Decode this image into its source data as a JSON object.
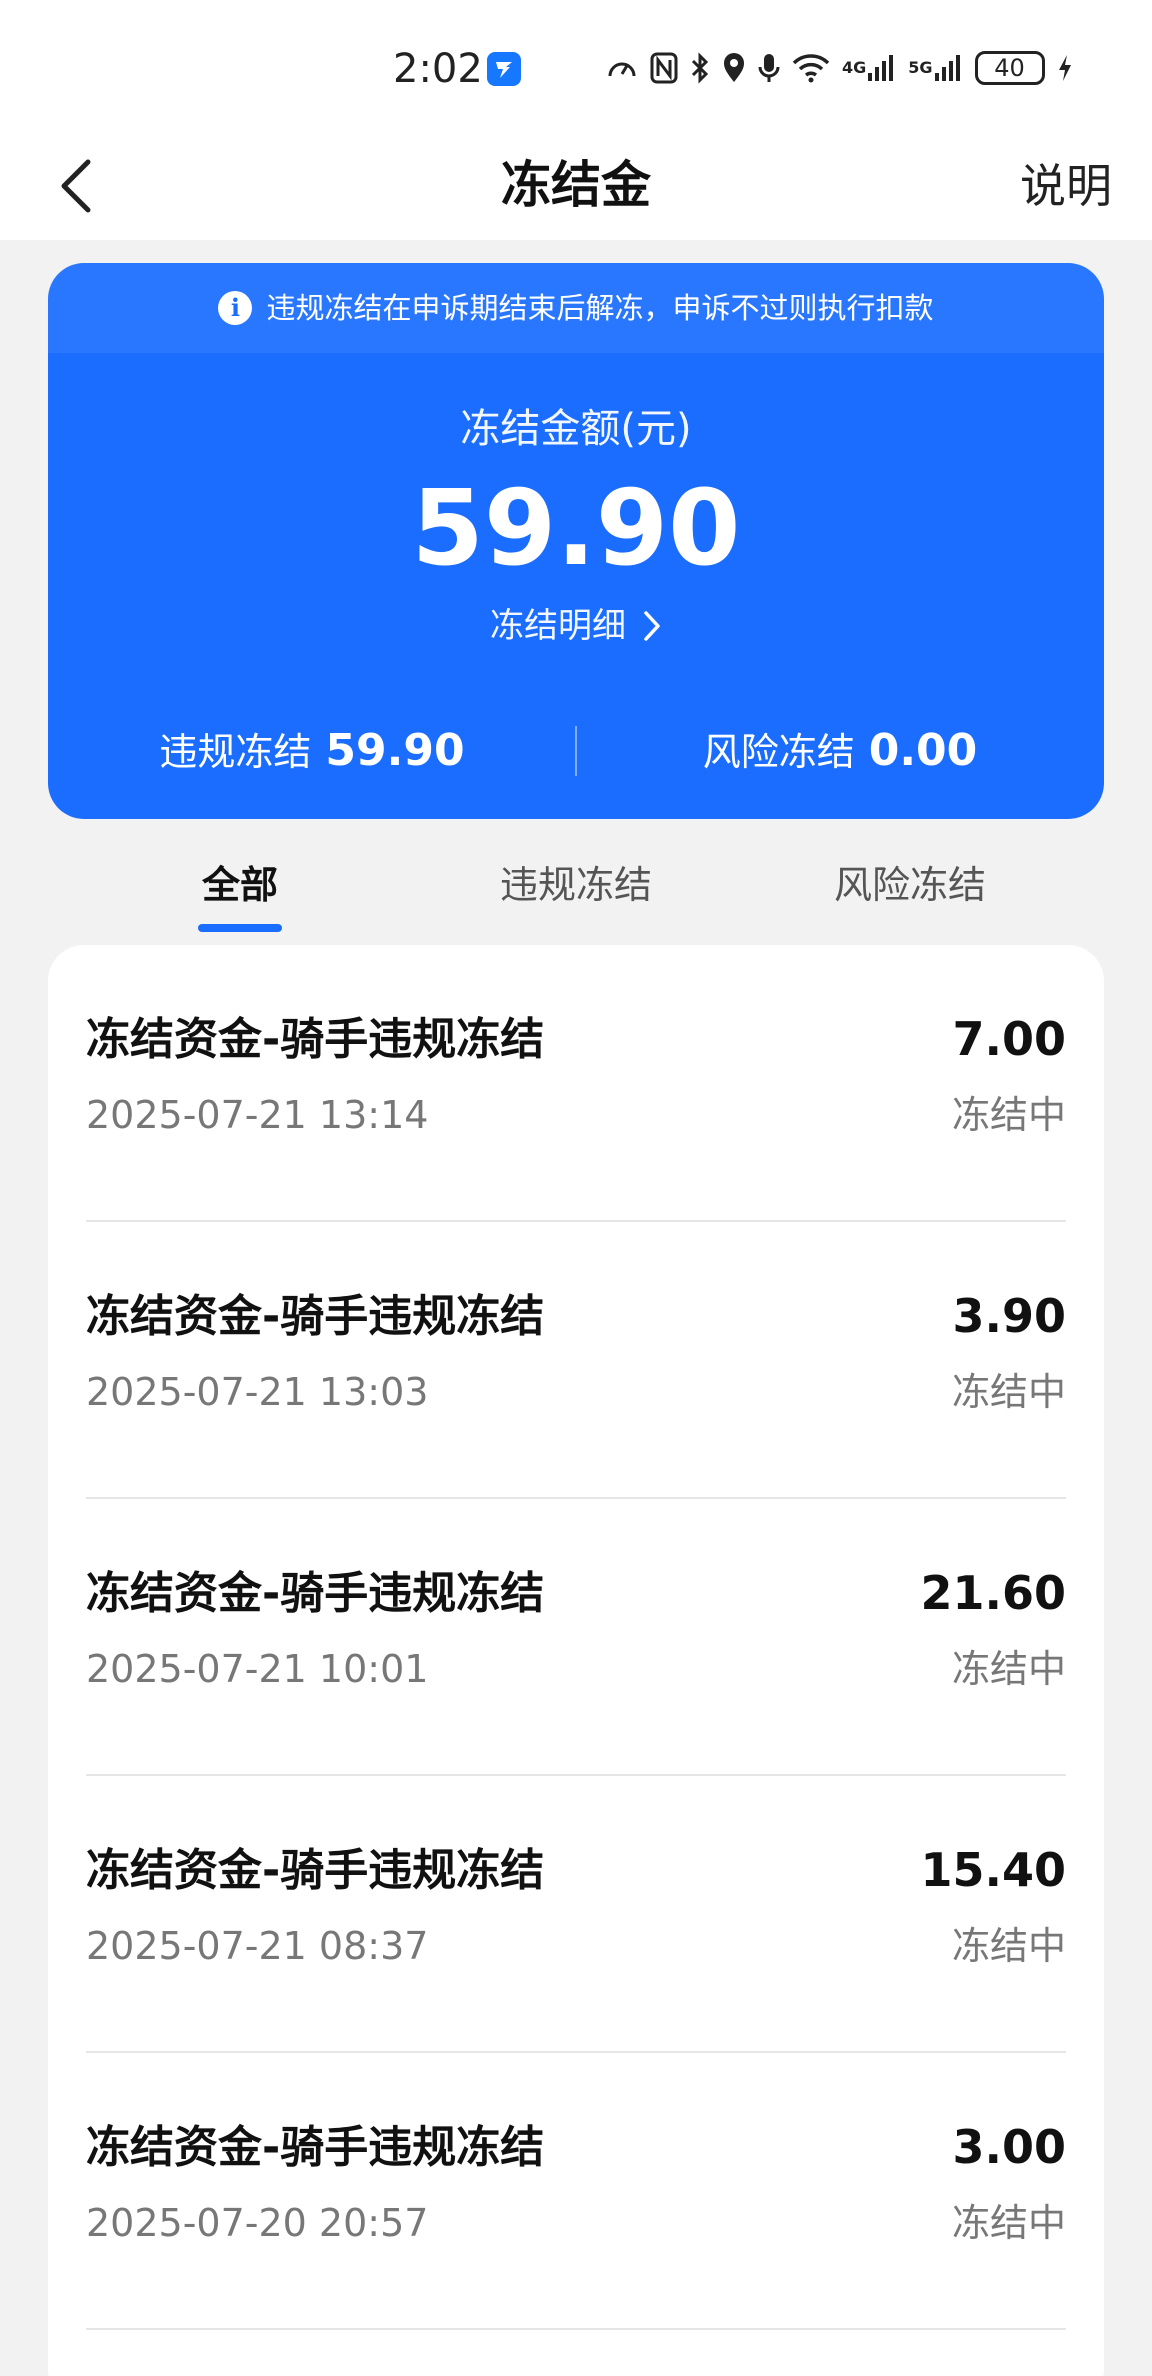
{
  "status_bar": {
    "time": "2:02",
    "network_4g": "4G",
    "network_5g": "5G",
    "battery": "40",
    "icons": [
      "speed-icon",
      "nfc-icon",
      "bluetooth-icon",
      "location-icon",
      "mic-icon",
      "wifi-icon",
      "signal-icon",
      "charging-icon"
    ]
  },
  "nav": {
    "title": "冻结金",
    "help": "说明"
  },
  "card": {
    "notice": "违规冻结在申诉期结束后解冻，申诉不过则执行扣款",
    "amount_label": "冻结金额(元)",
    "amount_value": "59.90",
    "detail_link": "冻结明细",
    "violation_label": "违规冻结",
    "violation_value": "59.90",
    "risk_label": "风险冻结",
    "risk_value": "0.00",
    "color": "#1a6dff"
  },
  "tabs": [
    {
      "label": "全部",
      "active": true
    },
    {
      "label": "违规冻结",
      "active": false
    },
    {
      "label": "风险冻结",
      "active": false
    }
  ],
  "records": [
    {
      "title": "冻结资金-骑手违规冻结",
      "time": "2025-07-21 13:14",
      "amount": "7.00",
      "status": "冻结中"
    },
    {
      "title": "冻结资金-骑手违规冻结",
      "time": "2025-07-21 13:03",
      "amount": "3.90",
      "status": "冻结中"
    },
    {
      "title": "冻结资金-骑手违规冻结",
      "time": "2025-07-21 10:01",
      "amount": "21.60",
      "status": "冻结中"
    },
    {
      "title": "冻结资金-骑手违规冻结",
      "time": "2025-07-21 08:37",
      "amount": "15.40",
      "status": "冻结中"
    },
    {
      "title": "冻结资金-骑手违规冻结",
      "time": "2025-07-20 20:57",
      "amount": "3.00",
      "status": "冻结中"
    }
  ]
}
